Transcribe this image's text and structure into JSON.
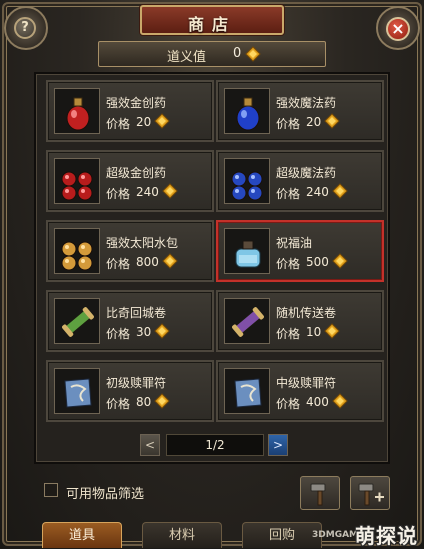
{
  "window": {
    "title": "商店",
    "help_glyph": "?",
    "close_glyph": "×"
  },
  "favor": {
    "label": "道义值",
    "value": "0"
  },
  "currency_icon": "gold-ingot-icon",
  "items": [
    {
      "name": "强效金创药",
      "price_label": "价格",
      "price": "20",
      "icon": "red-potion-icon",
      "selected": false
    },
    {
      "name": "强效魔法药",
      "price_label": "价格",
      "price": "20",
      "icon": "blue-potion-icon",
      "selected": false
    },
    {
      "name": "超级金创药",
      "price_label": "价格",
      "price": "240",
      "icon": "red-potion-bundle-icon",
      "selected": false
    },
    {
      "name": "超级魔法药",
      "price_label": "价格",
      "price": "240",
      "icon": "blue-potion-bundle-icon",
      "selected": false
    },
    {
      "name": "强效太阳水包",
      "price_label": "价格",
      "price": "800",
      "icon": "sun-water-bundle-icon",
      "selected": false
    },
    {
      "name": "祝福油",
      "price_label": "价格",
      "price": "500",
      "icon": "blessing-oil-icon",
      "selected": true
    },
    {
      "name": "比奇回城卷",
      "price_label": "价格",
      "price": "30",
      "icon": "green-scroll-icon",
      "selected": false
    },
    {
      "name": "随机传送卷",
      "price_label": "价格",
      "price": "10",
      "icon": "purple-scroll-icon",
      "selected": false
    },
    {
      "name": "初级赎罪符",
      "price_label": "价格",
      "price": "80",
      "icon": "talisman-icon",
      "selected": false
    },
    {
      "name": "中级赎罪符",
      "price_label": "价格",
      "price": "400",
      "icon": "talisman-icon",
      "selected": false
    }
  ],
  "pager": {
    "prev_glyph": "<",
    "next_glyph": ">",
    "page_text": "1/2"
  },
  "filter": {
    "label": "可用物品筛选"
  },
  "tools": [
    {
      "icon": "hammer-icon"
    },
    {
      "icon": "hammer-plus-icon"
    }
  ],
  "tabs": [
    {
      "label": "道具",
      "active": true
    },
    {
      "label": "材料",
      "active": false
    },
    {
      "label": "回购",
      "active": false
    }
  ],
  "watermark": {
    "main": "萌探说",
    "small": "3DMGAME"
  },
  "colors": {
    "title_bar": "#7a2f20",
    "selected_border": "#c4312a",
    "active_tab": "#9a5c22",
    "next_button": "#2f64a8"
  }
}
